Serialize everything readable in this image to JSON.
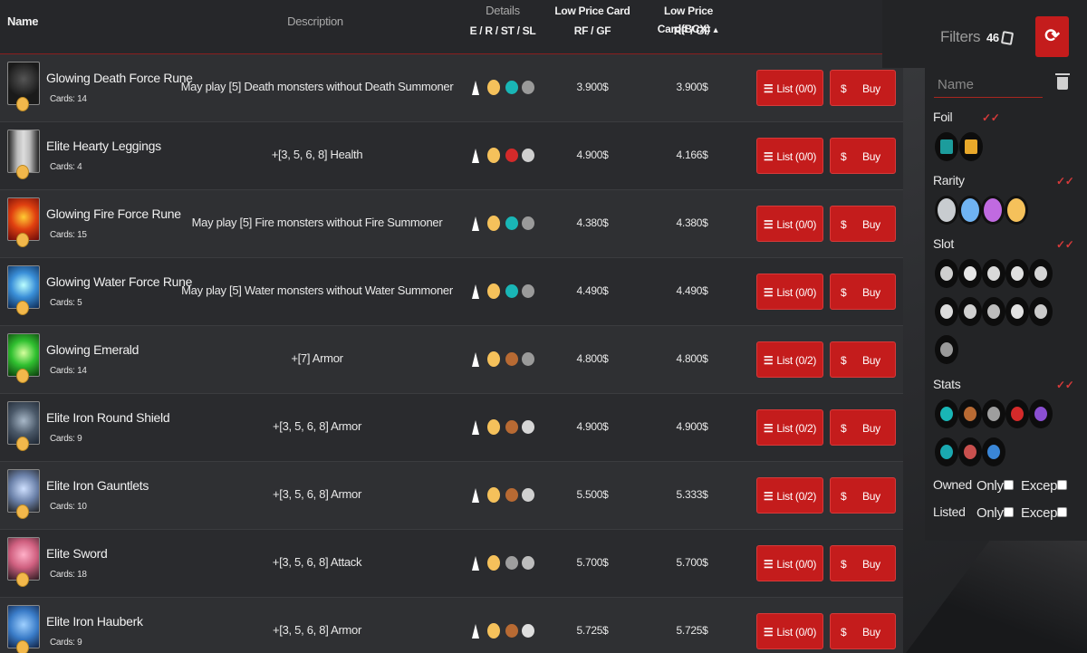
{
  "columns": {
    "name": "Name",
    "description": "Description",
    "details": "Details",
    "details_sub": "E / R / ST / SL",
    "low_price_card": "Low Price Card",
    "low_price_card_sub": "RF / GF",
    "low_price_bcx": "Low Price Card(BCX)",
    "low_price_bcx_sub": "RF / GF",
    "sort_indicator": "▲"
  },
  "rows": [
    {
      "name": "Glowing Death Force Rune",
      "cards": "Cards: 14",
      "description": "May play [5] Death monsters without Death Summoner",
      "price_card": "3.900$",
      "price_bcx": "3.900$",
      "list_label": "List (0/0)",
      "buy_label": "Buy",
      "stat_icon": "mana-icon",
      "slot_icon": "rune-slot-icon"
    },
    {
      "name": "Elite Hearty Leggings",
      "cards": "Cards: 4",
      "description": "+[3, 5, 6, 8] Health",
      "price_card": "4.900$",
      "price_bcx": "4.166$",
      "list_label": "List (0/0)",
      "buy_label": "Buy",
      "stat_icon": "heart-icon",
      "slot_icon": "legs-slot-icon"
    },
    {
      "name": "Glowing Fire Force Rune",
      "cards": "Cards: 15",
      "description": "May play [5] Fire monsters without Fire Summoner",
      "price_card": "4.380$",
      "price_bcx": "4.380$",
      "list_label": "List (0/0)",
      "buy_label": "Buy",
      "stat_icon": "mana-icon",
      "slot_icon": "rune-slot-icon"
    },
    {
      "name": "Glowing Water Force Rune",
      "cards": "Cards: 5",
      "description": "May play [5] Water monsters without Water Summoner",
      "price_card": "4.490$",
      "price_bcx": "4.490$",
      "list_label": "List (0/0)",
      "buy_label": "Buy",
      "stat_icon": "mana-icon",
      "slot_icon": "rune-slot-icon"
    },
    {
      "name": "Glowing Emerald",
      "cards": "Cards: 14",
      "description": "+[7] Armor",
      "price_card": "4.800$",
      "price_bcx": "4.800$",
      "list_label": "List (0/2)",
      "buy_label": "Buy",
      "stat_icon": "armor-icon",
      "slot_icon": "rune-slot-icon"
    },
    {
      "name": "Elite Iron Round Shield",
      "cards": "Cards: 9",
      "description": "+[3, 5, 6, 8] Armor",
      "price_card": "4.900$",
      "price_bcx": "4.900$",
      "list_label": "List (0/2)",
      "buy_label": "Buy",
      "stat_icon": "armor-icon",
      "slot_icon": "shield-slot-icon"
    },
    {
      "name": "Elite Iron Gauntlets",
      "cards": "Cards: 10",
      "description": "+[3, 5, 6, 8] Armor",
      "price_card": "5.500$",
      "price_bcx": "5.333$",
      "list_label": "List (0/2)",
      "buy_label": "Buy",
      "stat_icon": "armor-icon",
      "slot_icon": "hands-slot-icon"
    },
    {
      "name": "Elite Sword",
      "cards": "Cards: 18",
      "description": "+[3, 5, 6, 8] Attack",
      "price_card": "5.700$",
      "price_bcx": "5.700$",
      "list_label": "List (0/0)",
      "buy_label": "Buy",
      "stat_icon": "attack-icon",
      "slot_icon": "weapon-slot-icon"
    },
    {
      "name": "Elite Iron Hauberk",
      "cards": "Cards: 9",
      "description": "+[3, 5, 6, 8] Armor",
      "price_card": "5.725$",
      "price_bcx": "5.725$",
      "list_label": "List (0/0)",
      "buy_label": "Buy",
      "stat_icon": "armor-icon",
      "slot_icon": "chest-slot-icon"
    }
  ],
  "colors": {
    "accent_red": "#c41c1c",
    "gold": "#f5c15b",
    "background": "#2d2e30"
  },
  "filters": {
    "title": "Filters",
    "count": "46",
    "name_placeholder": "Name",
    "foil_label": "Foil",
    "rarity_label": "Rarity",
    "slot_label": "Slot",
    "stats_label": "Stats",
    "owned_label": "Owned",
    "listed_label": "Listed",
    "only_label": "Only",
    "except_label": "Except",
    "check_mark": "✓✓"
  }
}
